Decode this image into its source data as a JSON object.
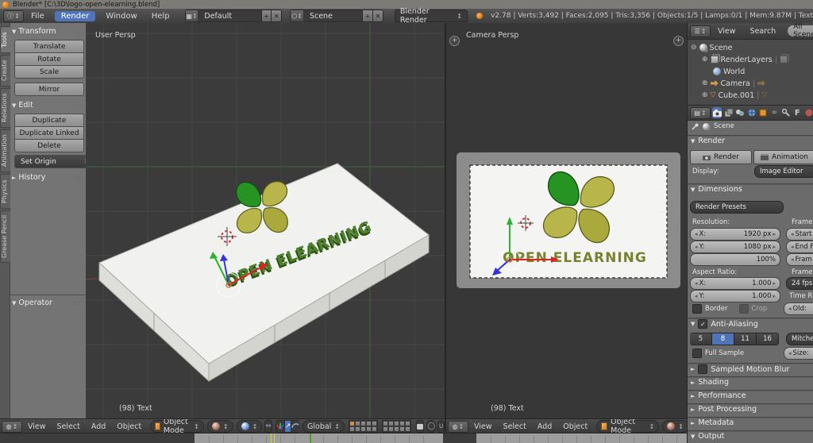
{
  "window": {
    "title": "Blender* [C:\\3D\\logo-open-elearning.blend]"
  },
  "topbar": {
    "menus": [
      "File",
      "Render",
      "Window",
      "Help"
    ],
    "layout_value": "Default",
    "scene_value": "Scene",
    "engine_value": "Blender Render",
    "stats": "v2.78 | Verts:3,492 | Faces:2,095 | Tris:3,356 | Objects:1/5 | Lamps:0/1 | Mem:9.87M | Text"
  },
  "tool_shelf": {
    "tabs": [
      "Tools",
      "Create",
      "Relations",
      "Animation",
      "Physics",
      "Grease Pencil"
    ],
    "transform_title": "Transform",
    "transform_buttons": [
      "Translate",
      "Rotate",
      "Scale",
      "Mirror"
    ],
    "edit_title": "Edit",
    "edit_buttons": [
      "Duplicate",
      "Duplicate Linked",
      "Delete"
    ],
    "set_origin": "Set Origin",
    "history_title": "History",
    "operator_title": "Operator"
  },
  "viewport_left": {
    "view_label": "User Persp",
    "object_label": "(98) Text",
    "logo_text": "OPEN ELEARNING",
    "menus": [
      "View",
      "Select",
      "Add",
      "Object"
    ],
    "mode": "Object Mode",
    "orientation": "Global"
  },
  "viewport_right": {
    "view_label": "Camera Persp",
    "object_label": "(98) Text",
    "logo_text": "OPEN ELEARNING",
    "menus": [
      "View",
      "Select",
      "Add",
      "Object"
    ],
    "mode": "Object Mode"
  },
  "outliner": {
    "menus": [
      "View",
      "Search"
    ],
    "filter_label": "All Scenes",
    "items": [
      {
        "label": "Scene"
      },
      {
        "label": "RenderLayers"
      },
      {
        "label": "World"
      },
      {
        "label": "Camera"
      },
      {
        "label": "Cube.001"
      }
    ]
  },
  "properties": {
    "breadcrumb": "Scene",
    "render": {
      "title": "Render",
      "render_button": "Render",
      "animation_button": "Animation",
      "display_label": "Display:",
      "display_value": "Image Editor"
    },
    "dimensions": {
      "title": "Dimensions",
      "presets": "Render Presets",
      "resolution_label": "Resolution:",
      "res_x_label": "X:",
      "res_x_value": "1920 px",
      "res_y_label": "Y:",
      "res_y_value": "1080 px",
      "res_scale": "100%",
      "aspect_label": "Aspect Ratio:",
      "aspect_x_label": "X:",
      "aspect_x_value": "1.000",
      "aspect_y_label": "Y:",
      "aspect_y_value": "1.000",
      "border_label": "Border",
      "crop_label": "Crop",
      "frame_range_label": "Frame",
      "start_label": "Start",
      "end_label": "End F",
      "step_label": "Fram",
      "frame_rate_label": "Frame",
      "fps_value": "24 fps",
      "time_label": "Time R",
      "old_label": "Old:"
    },
    "anti_aliasing": {
      "title": "Anti-Aliasing",
      "samples": [
        "5",
        "8",
        "11",
        "16"
      ],
      "filter_value": "Mitchel",
      "full_sample_label": "Full Sample",
      "size_label": "Size:"
    },
    "panels": [
      "Sampled Motion Blur",
      "Shading",
      "Performance",
      "Post Processing",
      "Metadata"
    ],
    "output_title": "Output"
  },
  "colors": {
    "accent_blue": "#4f74b8",
    "blender_orange": "#e87d0d",
    "logo_green": "#259422",
    "logo_olive": "#b8b64a",
    "viewport_bg": "#3b3b3b"
  }
}
